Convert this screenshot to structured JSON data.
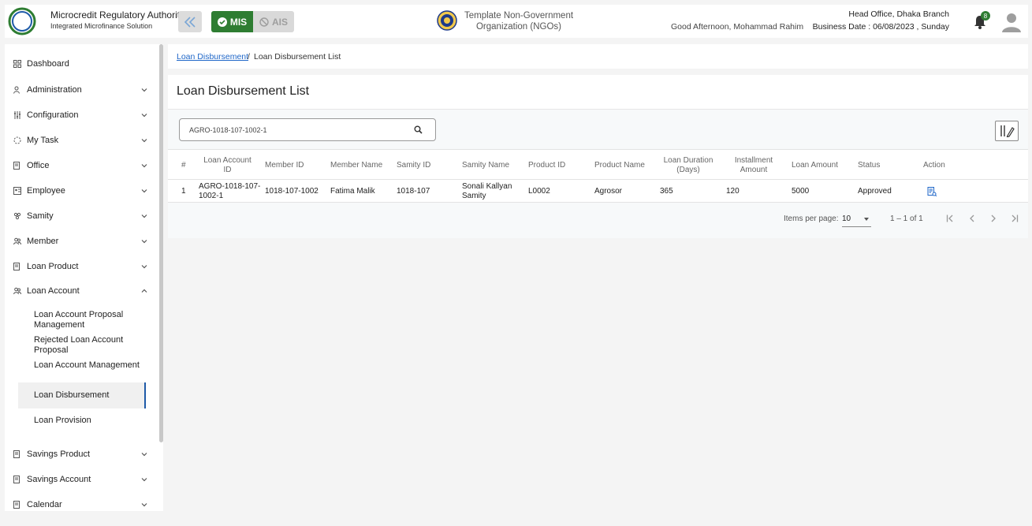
{
  "header": {
    "brand_title": "Microcredit Regulatory Authority",
    "brand_subtitle": "Integrated Microfinance Solution",
    "logo_text": "Microcredit Regulatory Authority",
    "mis_label": "MIS",
    "ais_label": "AIS",
    "org_name_line1": "Template Non-Government",
    "org_name_line2": "Organization (NGOs)",
    "greeting": "Good Afternoon, Mohammad Rahim",
    "branch": "Head Office, Dhaka Branch",
    "business_date": "Business Date : 06/08/2023 , Sunday",
    "notification_count": "8",
    "accent_color": "#2e7d32"
  },
  "sidebar": {
    "dashboard": "Dashboard",
    "items": [
      {
        "label": "Administration",
        "icon": "admin-icon"
      },
      {
        "label": "Configuration",
        "icon": "sliders-icon"
      },
      {
        "label": "My Task",
        "icon": "spinner-icon"
      },
      {
        "label": "Office",
        "icon": "document-icon"
      },
      {
        "label": "Employee",
        "icon": "id-card-icon"
      },
      {
        "label": "Samity",
        "icon": "group-icon"
      },
      {
        "label": "Member",
        "icon": "people-icon"
      },
      {
        "label": "Loan Product",
        "icon": "document-icon"
      },
      {
        "label": "Loan Account",
        "icon": "people-icon"
      },
      {
        "label": "Savings Product",
        "icon": "document-icon"
      },
      {
        "label": "Savings Account",
        "icon": "document-icon"
      },
      {
        "label": "Calendar",
        "icon": "document-icon"
      }
    ],
    "sub_items": [
      "Loan Account Proposal Management",
      "Rejected Loan Account Proposal",
      "Loan Account Management",
      "Loan Disbursement",
      "Loan Provision"
    ]
  },
  "breadcrumb": {
    "parent": "Loan Disbursement",
    "separator": "/",
    "current": "Loan Disbursement List"
  },
  "main": {
    "title": "Loan Disbursement List",
    "search_value": "AGRO-1018-107-1002-1",
    "columns": [
      "#",
      "Loan Account ID",
      "Member ID",
      "Member Name",
      "Samity ID",
      "Samity Name",
      "Product ID",
      "Product Name",
      "Loan Duration (Days)",
      "Installment Amount",
      "Loan Amount",
      "Status",
      "Action"
    ],
    "rows": [
      {
        "no": "1",
        "loan_account_id": "AGRO-1018-107-1002-1",
        "member_id": "1018-107-1002",
        "member_name": "Fatima Malik",
        "samity_id": "1018-107",
        "samity_name": "Sonali Kallyan Samity",
        "product_id": "L0002",
        "product_name": "Agrosor",
        "duration": "365",
        "installment": "120",
        "amount": "5000",
        "status": "Approved"
      }
    ],
    "paginator": {
      "items_per_page_label": "Items per page:",
      "items_per_page": "10",
      "range": "1 – 1 of 1"
    }
  }
}
